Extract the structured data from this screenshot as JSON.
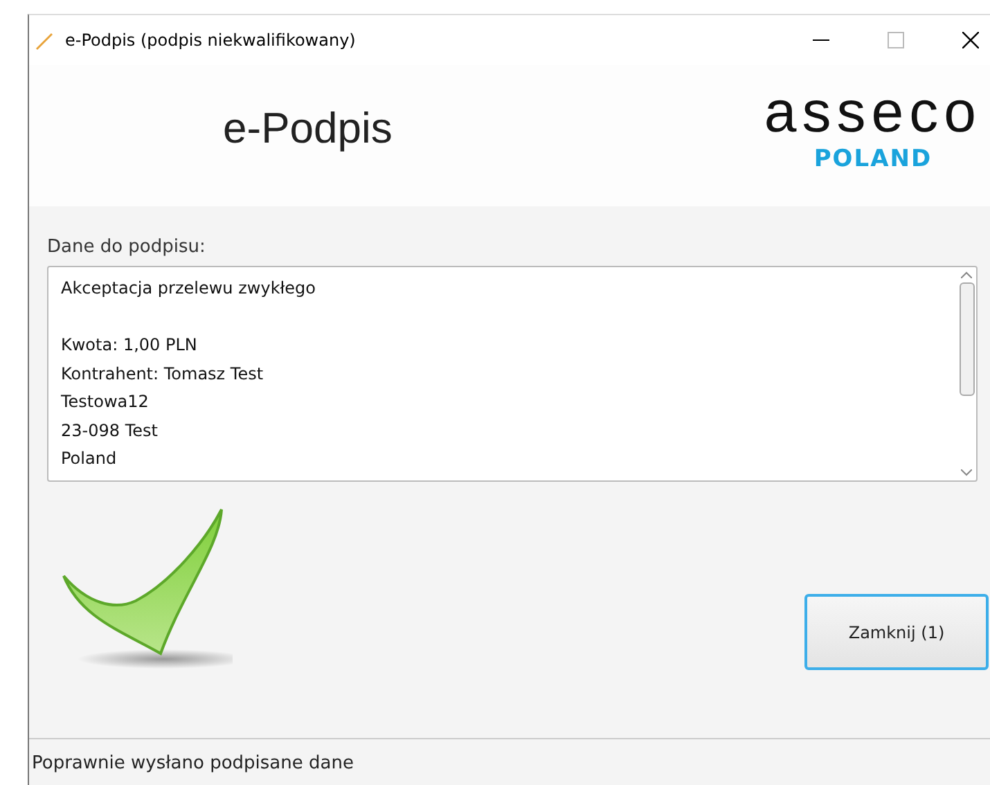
{
  "window": {
    "title": "e-Podpis (podpis niekwalifikowany)"
  },
  "header": {
    "title": "e-Podpis",
    "logo": "asseco",
    "logo_subtitle": "POLAND"
  },
  "data_section": {
    "label": "Dane do podpisu:",
    "paragraphs": [
      [
        "Akceptacja przelewu zwykłego"
      ],
      [
        "Kwota: 1,00 PLN",
        "Kontrahent: Tomasz Test",
        "Testowa12",
        "23-098 Test",
        "Poland"
      ]
    ]
  },
  "buttons": [
    {
      "label": "Zamknij (1)",
      "selected": true
    }
  ],
  "status_bar": {
    "text": "Poprawnie wysłano podpisane dane"
  }
}
